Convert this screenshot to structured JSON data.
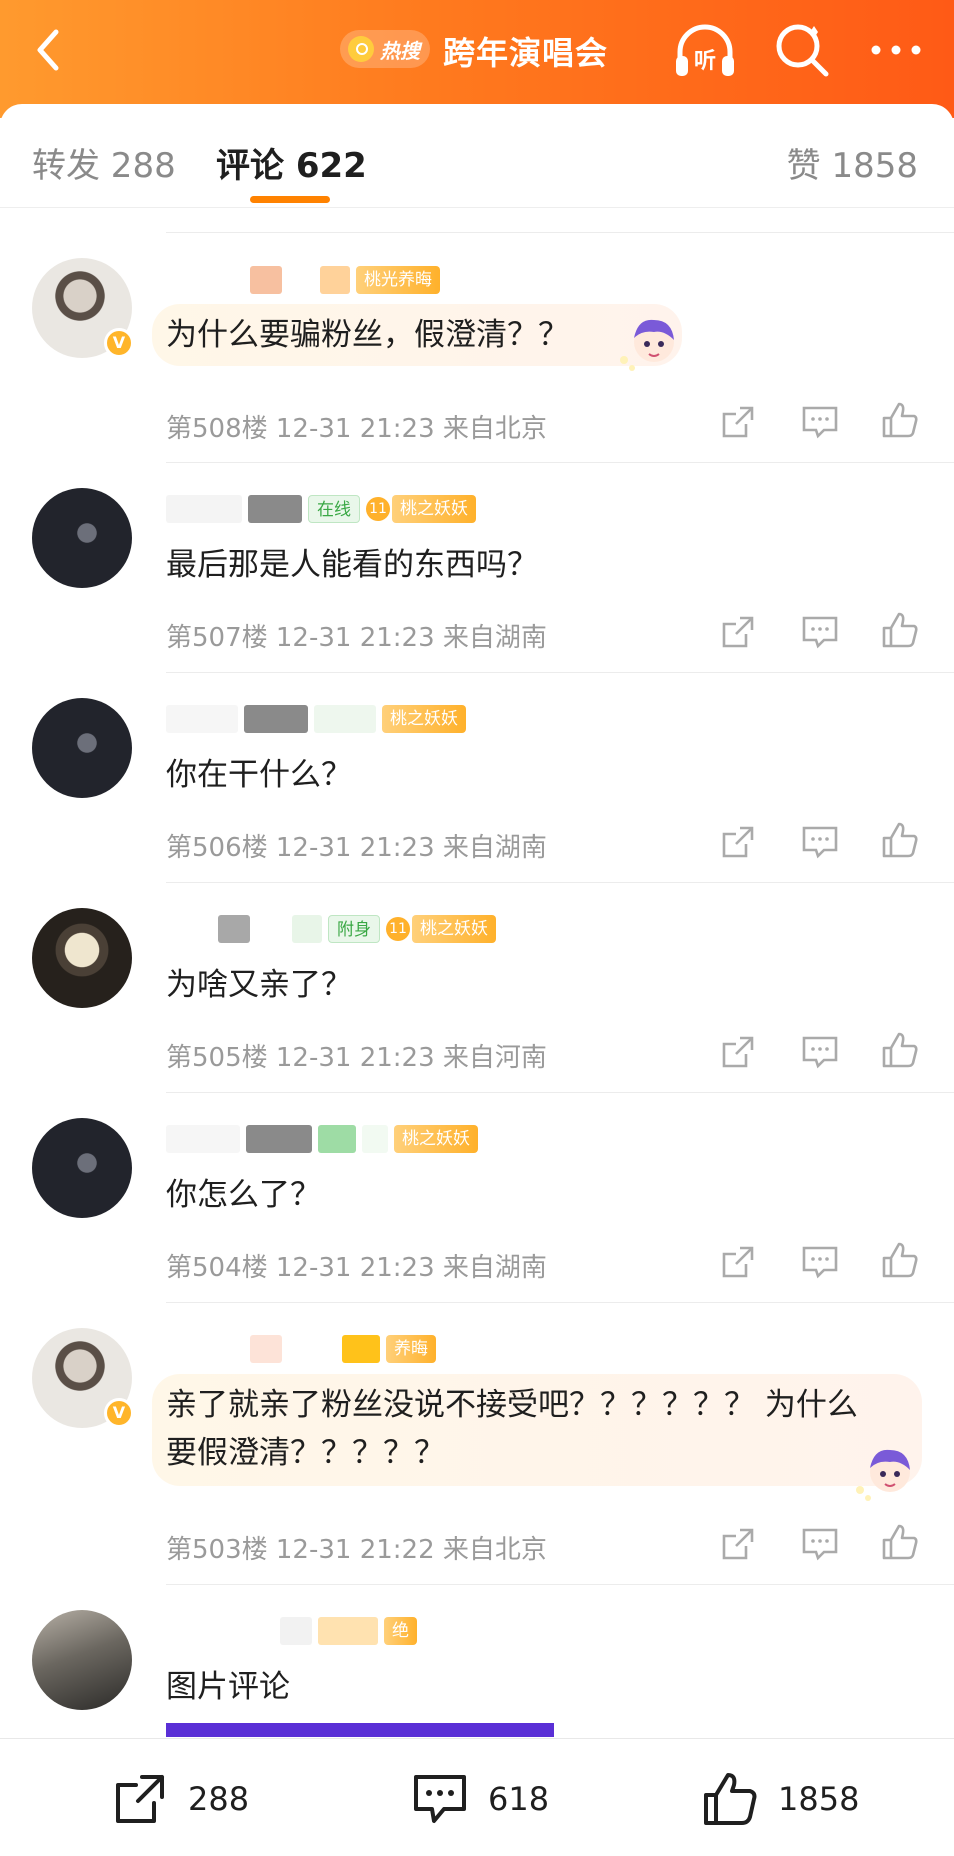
{
  "header": {
    "hot_label": "热搜",
    "topic_title": "跨年演唱会",
    "listen_label": "听",
    "icons": {
      "back": "chevron-left-icon",
      "listen": "headphones-icon",
      "search": "search-icon",
      "more": "more-icon"
    }
  },
  "tabs": {
    "repost": "转发 288",
    "comment": "评论 622",
    "like": "赞 1858"
  },
  "comments": [
    {
      "badges": [
        "桃光养晦"
      ],
      "text": "为什么要骗粉丝，假澄清？？",
      "meta": "第508楼 12-31 21:23 来自北京"
    },
    {
      "badges": [
        "在线",
        "11",
        "桃之妖妖"
      ],
      "text": "最后那是人能看的东西吗？",
      "meta": "第507楼 12-31 21:23 来自湖南"
    },
    {
      "badges": [
        "桃之妖妖"
      ],
      "text": "你在干什么？",
      "meta": "第506楼 12-31 21:23 来自湖南"
    },
    {
      "badges": [
        "附身",
        "11",
        "桃之妖妖"
      ],
      "text": "为啥又亲了？",
      "meta": "第505楼 12-31 21:23 来自河南"
    },
    {
      "badges": [
        "桃之妖妖"
      ],
      "text": "你怎么了？",
      "meta": "第504楼 12-31 21:23 来自湖南"
    },
    {
      "badges": [
        "养晦"
      ],
      "text_line1": "亲了就亲了粉丝没说不接受吧？？？？？？ 为什么",
      "text_line2": "要假澄清？？？？？",
      "meta": "第503楼 12-31 21:22 来自北京"
    },
    {
      "badges": [
        "绝"
      ],
      "text": "图片评论"
    }
  ],
  "bottom_bar": {
    "repost_count": "288",
    "comment_count": "618",
    "like_count": "1858"
  },
  "colors": {
    "accent": "#ff8200",
    "header_start": "#ff9a2e",
    "header_end": "#ff5a16",
    "badge": "#ffb12b"
  }
}
